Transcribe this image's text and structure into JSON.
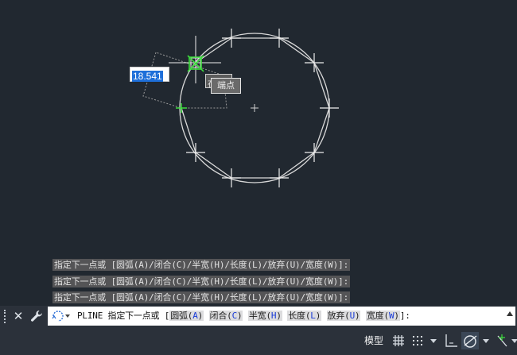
{
  "drawing": {
    "dynamic_input_value": "18.541",
    "snap_tooltip_back": "在",
    "snap_tooltip": "端点"
  },
  "command_history": [
    "指定下一点或 [圆弧(A)/闭合(C)/半宽(H)/长度(L)/放弃(U)/宽度(W)]:",
    "指定下一点或 [圆弧(A)/闭合(C)/半宽(H)/长度(L)/放弃(U)/宽度(W)]:",
    "指定下一点或 [圆弧(A)/闭合(C)/半宽(H)/长度(L)/放弃(U)/宽度(W)]:"
  ],
  "command_line": {
    "prompt": "PLINE 指定下一点或 [",
    "options": [
      {
        "label": "圆弧(",
        "key": "A",
        "close": ")"
      },
      {
        "label": "闭合(",
        "key": "C",
        "close": ")"
      },
      {
        "label": "半宽(",
        "key": "H",
        "close": ")"
      },
      {
        "label": "长度(",
        "key": "L",
        "close": ")"
      },
      {
        "label": "放弃(",
        "key": "U",
        "close": ")"
      },
      {
        "label": "宽度(",
        "key": "W",
        "close": ")"
      }
    ],
    "suffix": "]:"
  },
  "statusbar": {
    "model_label": "模型",
    "icons": [
      "grid-icon",
      "snap-grid-icon",
      "ortho-icon",
      "polar-tracking-icon",
      "object-snap-tracking-icon"
    ]
  },
  "colors": {
    "canvas": "#212830",
    "snap_marker": "#3ddc3d",
    "selection": "#1e6fd9",
    "hotkey": "#1a3cd8"
  }
}
